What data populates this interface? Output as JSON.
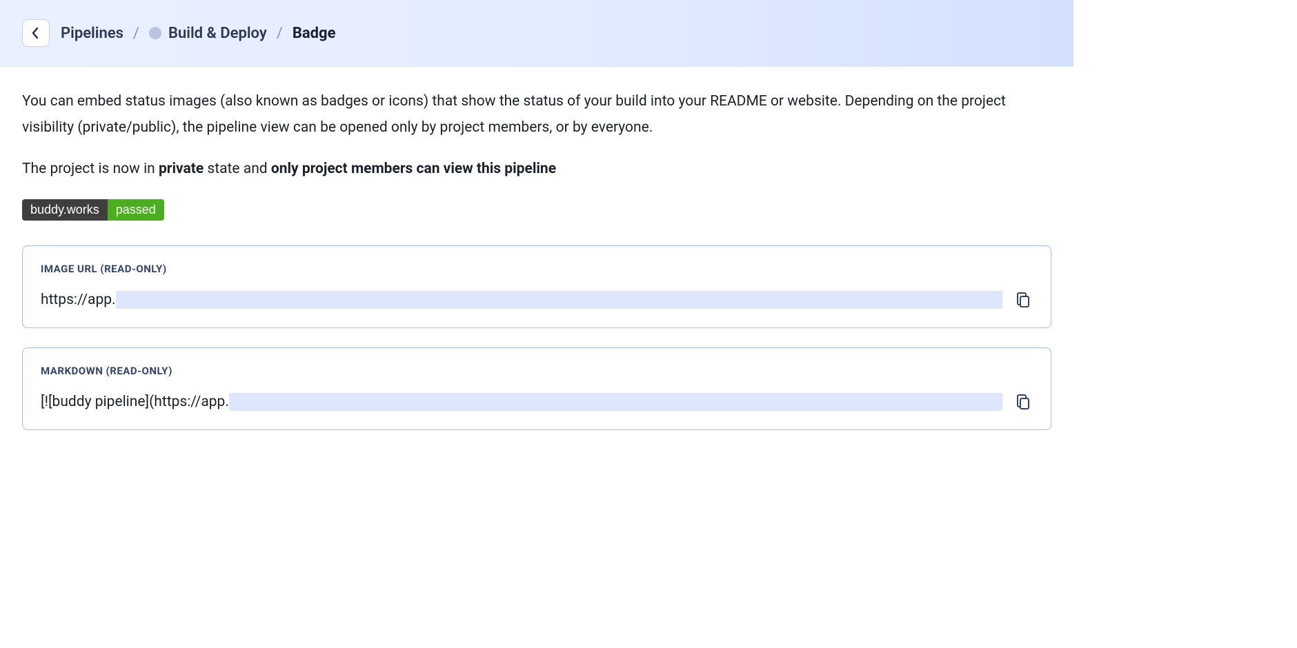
{
  "breadcrumb": {
    "root": "Pipelines",
    "pipeline": "Build & Deploy",
    "current": "Badge"
  },
  "description": "You can embed status images (also known as badges or icons) that show the status of your build into your README or website. Depending on the project visibility (private/public), the pipeline view can be opened only by project members, or by everyone.",
  "state_line": {
    "prefix": "The project is now in ",
    "state": "private",
    "mid": " state and ",
    "access": "only project members can view this pipeline"
  },
  "badge": {
    "left": "buddy.works",
    "right": "passed"
  },
  "boxes": {
    "image_url": {
      "label": "IMAGE URL (READ-ONLY)",
      "visible_prefix": "https://app."
    },
    "markdown": {
      "label": "MARKDOWN (READ-ONLY)",
      "visible_prefix": "[![buddy pipeline](https://app."
    }
  }
}
